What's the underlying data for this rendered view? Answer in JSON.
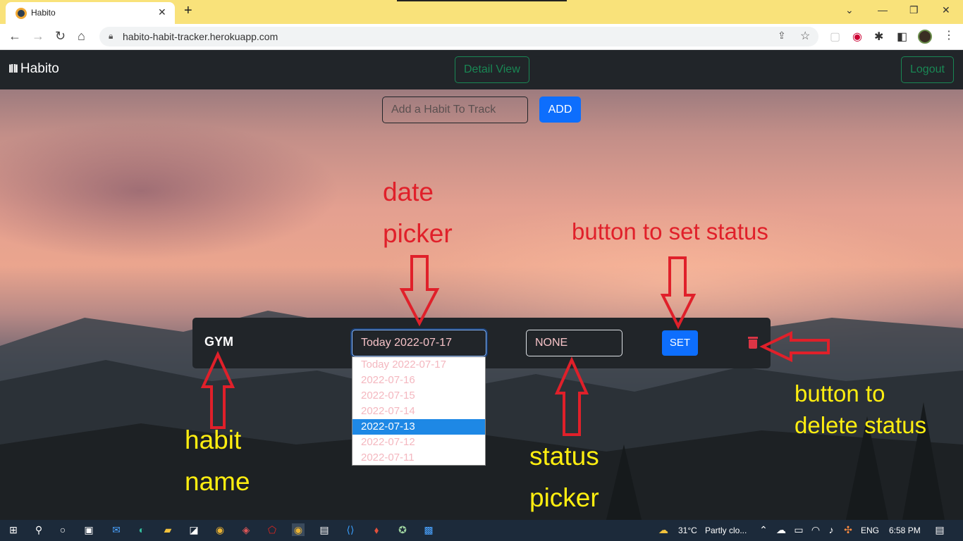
{
  "browser": {
    "tab_title": "Habito",
    "tab_close": "✕",
    "new_tab": "+",
    "url": "habito-habit-tracker.herokuapp.com",
    "window_controls": [
      "⌄",
      "—",
      "❐",
      "✕"
    ]
  },
  "navbar": {
    "brand": "Habito",
    "detail_view": "Detail View",
    "logout": "Logout"
  },
  "add_habit": {
    "placeholder": "Add a Habit To Track",
    "button": "ADD"
  },
  "habit": {
    "name": "GYM",
    "date_value": "Today 2022-07-17",
    "status_value": "NONE",
    "set_button": "SET"
  },
  "date_options": [
    {
      "label": "Today 2022-07-17",
      "selected": false
    },
    {
      "label": "2022-07-16",
      "selected": false
    },
    {
      "label": "2022-07-15",
      "selected": false
    },
    {
      "label": "2022-07-14",
      "selected": false
    },
    {
      "label": "2022-07-13",
      "selected": true
    },
    {
      "label": "2022-07-12",
      "selected": false
    },
    {
      "label": "2022-07-11",
      "selected": false
    }
  ],
  "annotations": {
    "date_picker_1": "date",
    "date_picker_2": "picker",
    "set_status": "button to set status",
    "delete_1": "button to",
    "delete_2": "delete status",
    "habit_1": "habit",
    "habit_2": "name",
    "status_1": "status",
    "status_2": "picker"
  },
  "taskbar": {
    "temperature": "31°C",
    "weather": "Partly clo...",
    "language": "ENG",
    "time": "6:58 PM"
  },
  "colors": {
    "brand_bar": "#212529",
    "primary": "#0d6efd",
    "success_outline": "#198754",
    "danger": "#dc3545",
    "annotation_red": "#e0202a",
    "annotation_yellow": "#ffee10"
  }
}
